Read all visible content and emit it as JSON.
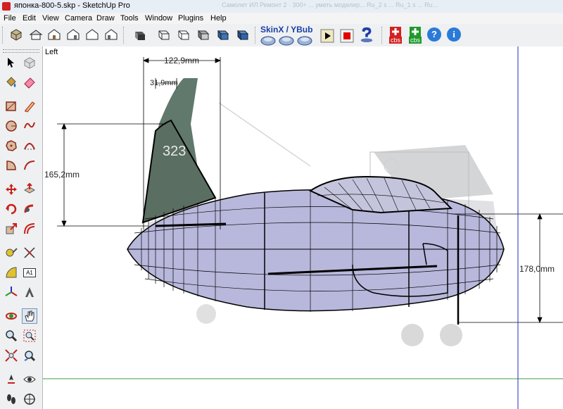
{
  "window": {
    "title": "японка-800-5.skp - SketchUp Pro",
    "ghost_tabs": "Самолет ИЛ Ремонт 2 · 300+  ...   уметь моделир...   Ru_2 s ...   Ru_1 s ...   Ru..."
  },
  "menu": [
    "File",
    "Edit",
    "View",
    "Camera",
    "Draw",
    "Tools",
    "Window",
    "Plugins",
    "Help"
  ],
  "toolbar": {
    "skin_label": "SkinX / YBub",
    "cbs1": "cbs",
    "cbs2": "cbs",
    "help_glyph": "?",
    "info_glyph": "i"
  },
  "tools": {
    "text_tool_label": "A1"
  },
  "viewport": {
    "view_name": "Left",
    "dim_width": "122,9mm",
    "dim_small": "31,9mm",
    "dim_height": "165,2mm",
    "dim_right": "178,0mm",
    "tail_number": "323"
  },
  "colors": {
    "accent_blue": "#1c3fa8",
    "fuselage": "#b8b8dc",
    "axis_green": "#3ca040",
    "axis_blue": "#2a2ad0"
  }
}
